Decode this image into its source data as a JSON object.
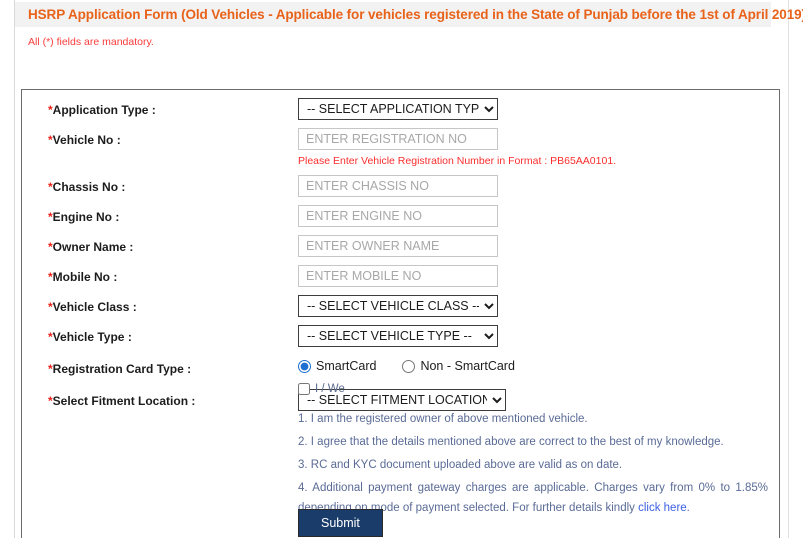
{
  "header": {
    "title": "HSRP Application Form (Old Vehicles - Applicable for vehicles registered in the State of Punjab before the 1st of April 2019)",
    "mandatory_note": "All (*) fields are mandatory.",
    "title_color": "#e8621a",
    "note_color": "#fa3c3c",
    "bar_background": "#f2f2f2"
  },
  "form": {
    "fields": [
      {
        "key": "application_type",
        "label": "Application Type :",
        "required": true,
        "control": "select",
        "value": "-- SELECT APPLICATION TYPE -"
      },
      {
        "key": "vehicle_no",
        "label": "Vehicle No :",
        "required": true,
        "control": "text",
        "value": "",
        "placeholder": "ENTER REGISTRATION NO",
        "hint": "Please Enter Vehicle Registration Number in Format : PB65AA0101."
      },
      {
        "key": "chassis_no",
        "label": "Chassis No :",
        "required": true,
        "control": "text",
        "value": "",
        "placeholder": "ENTER CHASSIS NO"
      },
      {
        "key": "engine_no",
        "label": "Engine No :",
        "required": true,
        "control": "text",
        "value": "",
        "placeholder": "ENTER ENGINE NO"
      },
      {
        "key": "owner_name",
        "label": "Owner Name :",
        "required": true,
        "control": "text",
        "value": "",
        "placeholder": "ENTER OWNER NAME"
      },
      {
        "key": "mobile_no",
        "label": "Mobile No :",
        "required": true,
        "control": "text",
        "value": "",
        "placeholder": "ENTER MOBILE NO"
      },
      {
        "key": "vehicle_class",
        "label": "Vehicle Class :",
        "required": true,
        "control": "select",
        "value": "-- SELECT VEHICLE CLASS --"
      },
      {
        "key": "vehicle_type",
        "label": "Vehicle Type :",
        "required": true,
        "control": "select",
        "value": "-- SELECT VEHICLE TYPE --"
      },
      {
        "key": "registration_card_type",
        "label": "Registration Card Type :",
        "required": true,
        "control": "radio",
        "options": [
          {
            "label": "SmartCard",
            "selected": true
          },
          {
            "label": "Non - SmartCard",
            "selected": false
          }
        ]
      },
      {
        "key": "fitment_location",
        "label": "Select Fitment Location :",
        "required": true,
        "control": "select",
        "value": "-- SELECT FITMENT LOCATION"
      }
    ]
  },
  "declaration": {
    "checkbox_label": "I / We",
    "checked": false,
    "items": [
      "1. I am the registered owner of above mentioned vehicle.",
      "2. I agree that the details mentioned above are correct to the best of my knowledge.",
      "3. RC and KYC document uploaded above are valid as on date."
    ],
    "item4_prefix": "4. Additional payment gateway charges are applicable. Charges vary from 0% to 1.85% depending on mode of payment selected. For further details kindly ",
    "item4_link": "click here",
    "item4_suffix": ".",
    "text_color": "#5a6b96",
    "link_color": "#3b5fe0"
  },
  "actions": {
    "submit_label": "Submit",
    "submit_color": "#1a3c6b"
  }
}
